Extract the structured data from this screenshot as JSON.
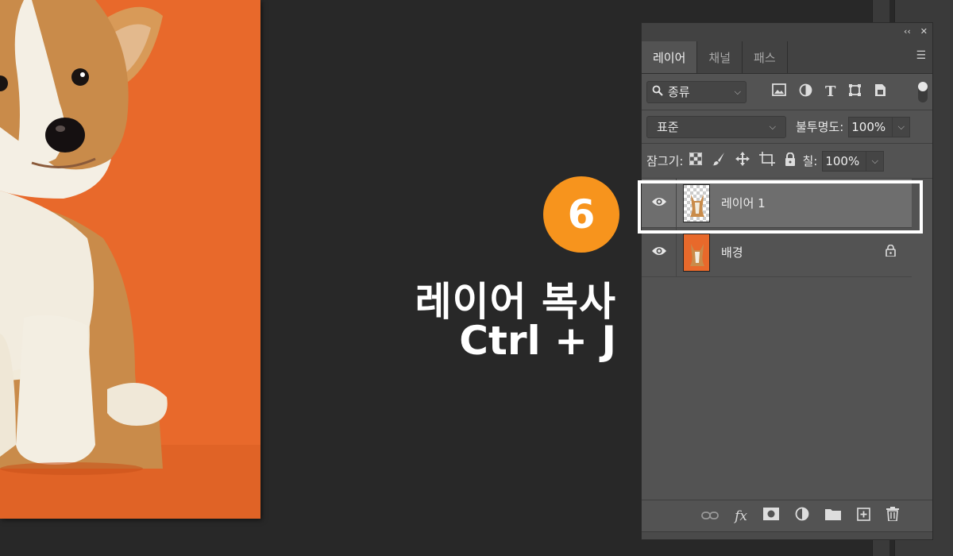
{
  "overlay": {
    "step_number": "6",
    "title": "레이어 복사",
    "shortcut": "Ctrl + J",
    "badge_color": "#f7941d"
  },
  "panel": {
    "collapse_icon": "double-chevron-left-icon",
    "close_icon": "close-icon",
    "tabs": [
      {
        "label": "레이어",
        "active": true
      },
      {
        "label": "채널",
        "active": false
      },
      {
        "label": "패스",
        "active": false
      }
    ],
    "filter": {
      "selected": "종류",
      "icons": [
        "image-filter-icon",
        "adjustment-filter-icon",
        "type-filter-icon",
        "shape-filter-icon",
        "smart-object-filter-icon"
      ]
    },
    "blend_mode": "표준",
    "opacity_label": "불투명도:",
    "opacity_value": "100%",
    "lock_label": "잠그기:",
    "fill_label": "칠:",
    "fill_value": "100%",
    "layers": [
      {
        "name": "레이어 1",
        "selected": true,
        "locked": false,
        "transparent": true
      },
      {
        "name": "배경",
        "selected": false,
        "locked": true,
        "transparent": false
      }
    ],
    "bottom_icons": [
      "link-icon",
      "fx-icon",
      "mask-icon",
      "adjustment-layer-icon",
      "group-folder-icon",
      "new-layer-icon",
      "trash-icon"
    ],
    "fx_label": "fx"
  },
  "colors": {
    "canvas_bg": "#e8692b",
    "workspace_bg": "#282828",
    "panel_bg": "#535353",
    "selected_layer": "#6e6e6e"
  }
}
